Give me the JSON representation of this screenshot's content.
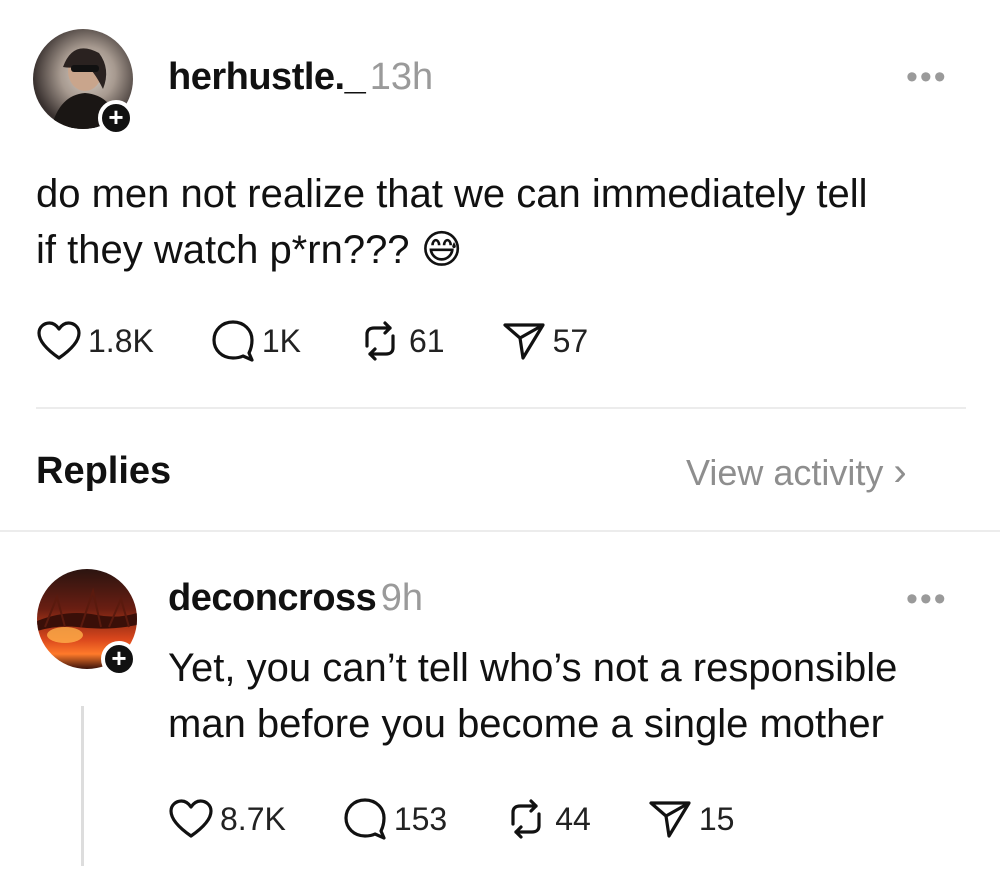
{
  "post": {
    "username": "herhustle._",
    "time": "13h",
    "more": "•••",
    "text_line1": "do men not realize that we can immediately tell",
    "text_line2": "if they watch p*rn???",
    "emoji": "😅",
    "likes": "1.8K",
    "comments": "1K",
    "reposts": "61",
    "shares": "57"
  },
  "replies_header": {
    "title": "Replies",
    "view_activity": "View activity",
    "chevron": "›"
  },
  "reply": {
    "username": "deconcross",
    "time": "9h",
    "more": "•••",
    "text_line1": "Yet, you can’t tell who’s not a responsible",
    "text_line2": "man before you become a single mother",
    "likes": "8.7K",
    "comments": "153",
    "reposts": "44",
    "shares": "15"
  },
  "icons": {
    "like": "heart-icon",
    "comment": "comment-icon",
    "repost": "repost-icon",
    "share": "send-icon",
    "follow": "plus-icon"
  },
  "colors": {
    "text": "#111111",
    "muted": "#9a9a9a",
    "divider": "#ececec"
  }
}
